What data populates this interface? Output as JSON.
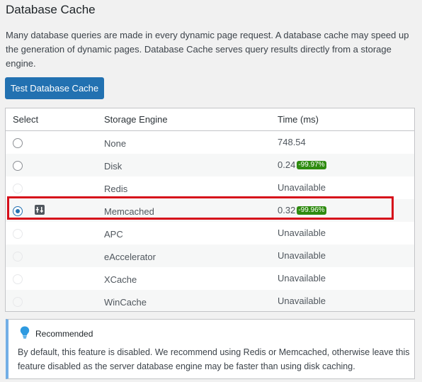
{
  "title": "Database Cache",
  "description": "Many database queries are made in every dynamic page request. A database cache may speed up the generation of dynamic pages. Database Cache serves query results directly from a storage engine.",
  "test_button": "Test Database Cache",
  "table": {
    "headers": [
      "Select",
      "Storage Engine",
      "Time (ms)"
    ],
    "rows": [
      {
        "engine": "None",
        "time": "748.54",
        "badge": "",
        "state": "unchecked"
      },
      {
        "engine": "Disk",
        "time": "0.24",
        "badge": "-99.97%",
        "state": "unchecked"
      },
      {
        "engine": "Redis",
        "time": "Unavailable",
        "badge": "",
        "state": "disabled"
      },
      {
        "engine": "Memcached",
        "time": "0.32",
        "badge": "-99.96%",
        "state": "checked"
      },
      {
        "engine": "APC",
        "time": "Unavailable",
        "badge": "",
        "state": "disabled"
      },
      {
        "engine": "eAccelerator",
        "time": "Unavailable",
        "badge": "",
        "state": "disabled"
      },
      {
        "engine": "XCache",
        "time": "Unavailable",
        "badge": "",
        "state": "disabled"
      },
      {
        "engine": "WinCache",
        "time": "Unavailable",
        "badge": "",
        "state": "disabled"
      }
    ]
  },
  "note": {
    "heading": "Recommended",
    "body": "By default, this feature is disabled. We recommend using Redis or Memcached, otherwise leave this feature disabled as the server database engine may be faster than using disk caching.",
    "icon": "lightbulb-icon"
  },
  "colors": {
    "accent": "#2271b1",
    "badge": "#2e8b10",
    "highlight": "#d60e1a",
    "note_border": "#72aee6"
  }
}
